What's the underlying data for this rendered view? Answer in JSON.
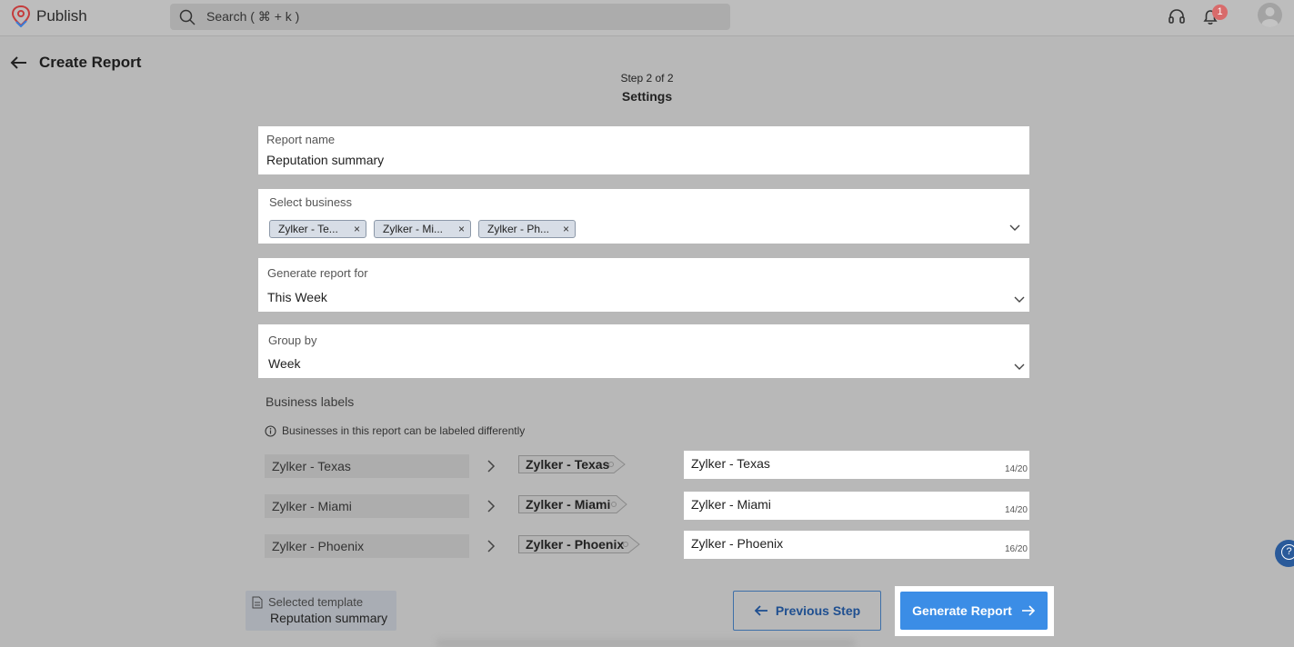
{
  "app": {
    "name": "Publish"
  },
  "search": {
    "placeholder": "Search ( ⌘ + k )"
  },
  "notifications": {
    "count": "1"
  },
  "header": {
    "title": "Create Report",
    "step": "Step 2 of 2",
    "step_title": "Settings"
  },
  "form": {
    "report_name": {
      "label": "Report name",
      "value": "Reputation summary"
    },
    "select_business": {
      "label": "Select business",
      "chips": [
        "Zylker - Te...",
        "Zylker - Mi...",
        "Zylker - Ph..."
      ]
    },
    "generate_for": {
      "label": "Generate report for",
      "value": "This Week"
    },
    "group_by": {
      "label": "Group by",
      "value": "Week"
    }
  },
  "business_labels": {
    "title": "Business labels",
    "info": "Businesses in this report can be labeled differently",
    "rows": [
      {
        "source": "Zylker - Texas",
        "tag": "Zylker - Texas",
        "value": "Zylker - Texas",
        "counter": "14/20"
      },
      {
        "source": "Zylker - Miami",
        "tag": "Zylker - Miami",
        "value": "Zylker - Miami",
        "counter": "14/20"
      },
      {
        "source": "Zylker - Phoenix",
        "tag": "Zylker - Phoenix",
        "value": "Zylker - Phoenix",
        "counter": "16/20"
      }
    ]
  },
  "template": {
    "label": "Selected template",
    "value": "Reputation summary"
  },
  "actions": {
    "previous": "Previous Step",
    "generate": "Generate Report"
  },
  "colors": {
    "primary": "#3b8de6",
    "outline": "#3e6fa8",
    "brand": "#d34a4a"
  },
  "icons": {
    "logo": "publish-logo-icon",
    "search": "search-icon",
    "support": "headset-icon",
    "bell": "bell-icon",
    "help": "help-icon"
  }
}
